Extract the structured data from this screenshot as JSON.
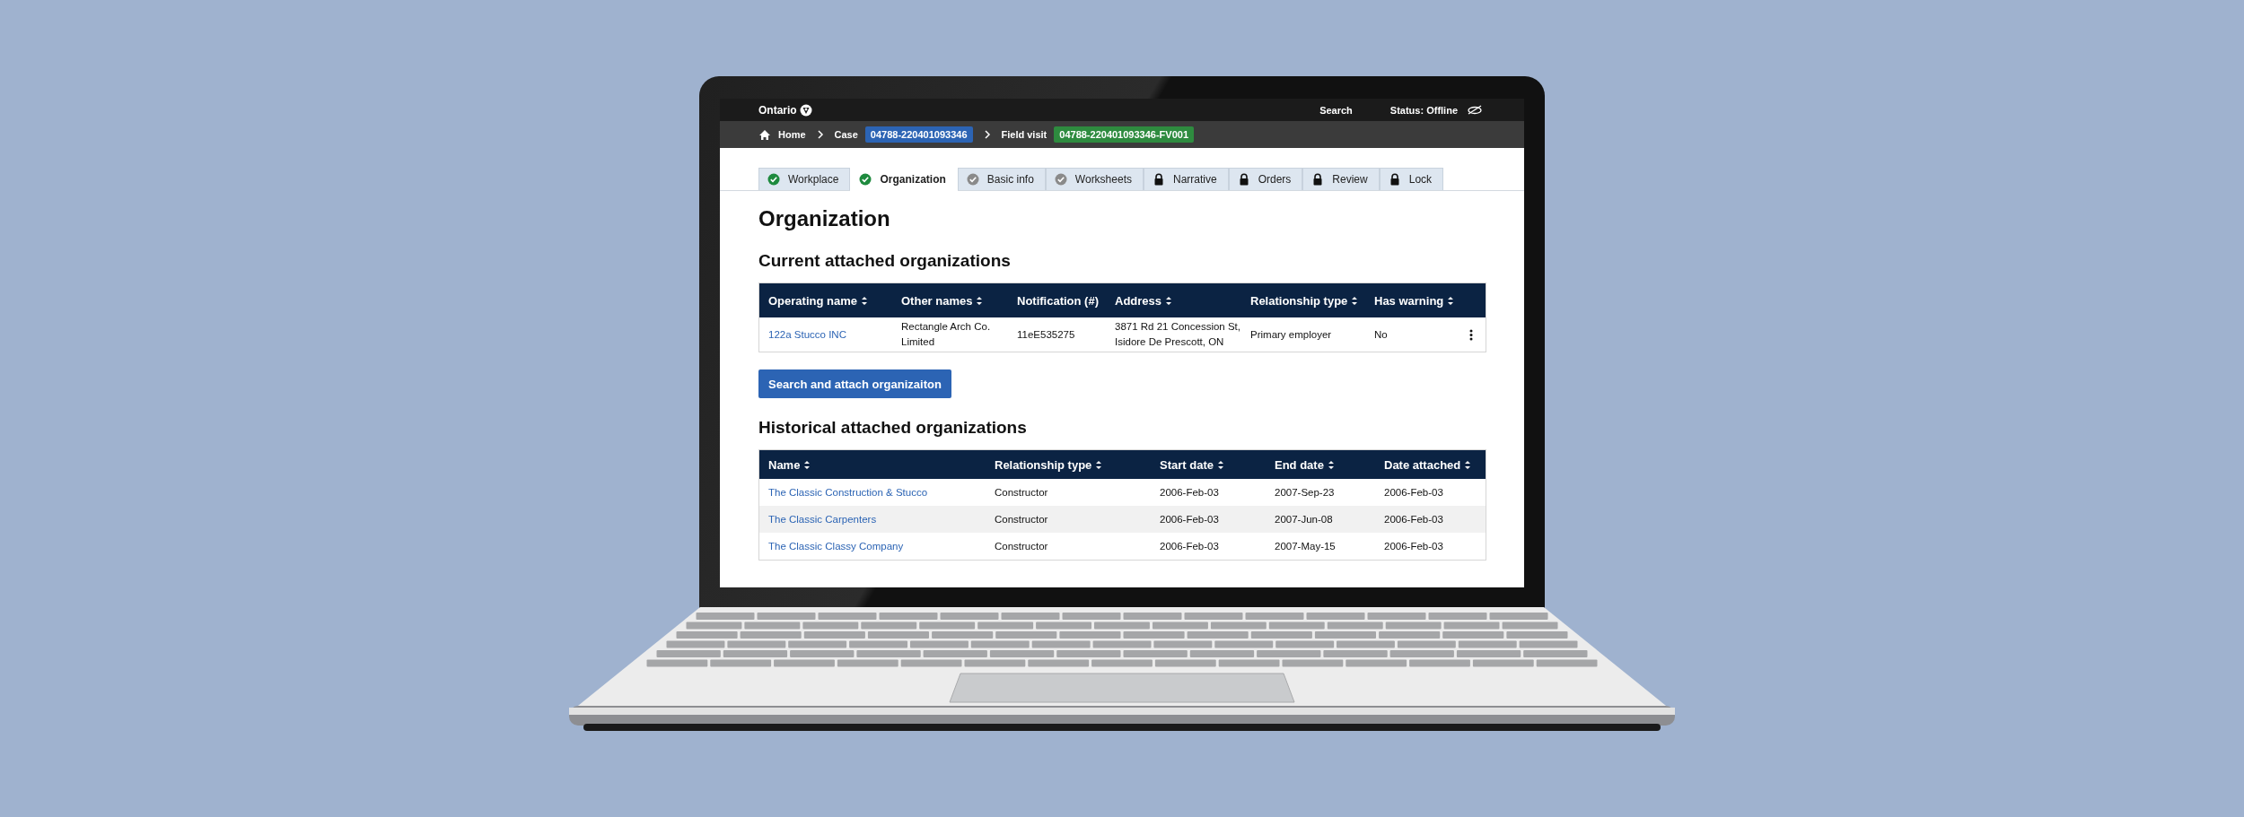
{
  "header": {
    "logo": "Ontario",
    "search": "Search",
    "status": "Status: Offline"
  },
  "breadcrumb": [
    {
      "kind": "home",
      "label": "Home"
    },
    {
      "kind": "badge",
      "label": "Case",
      "badge": "04788-220401093346",
      "color": "#2c64b4"
    },
    {
      "kind": "badge",
      "label": "Field visit",
      "badge": "04788-220401093346-FV001",
      "color": "#2e8b3f"
    }
  ],
  "tabs": [
    {
      "label": "Workplace",
      "kind": "complete",
      "selected": false
    },
    {
      "label": "Organization",
      "kind": "complete",
      "selected": true
    },
    {
      "label": "Basic info",
      "kind": "visited",
      "selected": false
    },
    {
      "label": "Worksheets",
      "kind": "visited",
      "selected": false
    },
    {
      "label": "Narrative",
      "kind": "locked",
      "selected": false
    },
    {
      "label": "Orders",
      "kind": "locked",
      "selected": false
    },
    {
      "label": "Review",
      "kind": "locked",
      "selected": false
    },
    {
      "label": "Lock",
      "kind": "locked",
      "selected": false
    }
  ],
  "page_title": "Organization",
  "current": {
    "title": "Current attached organizations",
    "columns": [
      {
        "label": "Operating name",
        "sortable": true,
        "kind": "link"
      },
      {
        "label": "Other names",
        "sortable": true,
        "kind": "text"
      },
      {
        "label": "Notification (#)",
        "sortable": false,
        "kind": "text"
      },
      {
        "label": "Address",
        "sortable": true,
        "kind": "text"
      },
      {
        "label": "Relationship type",
        "sortable": true,
        "kind": "text"
      },
      {
        "label": "Has warning",
        "sortable": true,
        "kind": "text"
      }
    ],
    "rows": [
      {
        "cells": [
          "122a Stucco INC",
          "Rectangle Arch Co. Limited",
          "11eE535275",
          "3871 Rd 21 Concession St, Isidore De Prescott, ON",
          "Primary employer",
          "No"
        ],
        "has_menu": true
      }
    ]
  },
  "attach_button": "Search and attach organizaiton",
  "historical": {
    "title": "Historical attached organizations",
    "columns": [
      {
        "label": "Name",
        "sortable": true,
        "kind": "link"
      },
      {
        "label": "Relationship type",
        "sortable": true,
        "kind": "text"
      },
      {
        "label": "Start date",
        "sortable": true,
        "kind": "text"
      },
      {
        "label": "End date",
        "sortable": true,
        "kind": "text"
      },
      {
        "label": "Date attached",
        "sortable": true,
        "kind": "text"
      }
    ],
    "rows": [
      {
        "cells": [
          "The Classic Construction & Stucco",
          "Constructor",
          "2006-Feb-03",
          "2007-Sep-23",
          "2006-Feb-03"
        ]
      },
      {
        "cells": [
          "The Classic Carpenters",
          "Constructor",
          "2006-Feb-03",
          "2007-Jun-08",
          "2006-Feb-03"
        ]
      },
      {
        "cells": [
          "The Classic Classy Company",
          "Constructor",
          "2006-Feb-03",
          "2007-May-15",
          "2006-Feb-03"
        ]
      }
    ]
  }
}
